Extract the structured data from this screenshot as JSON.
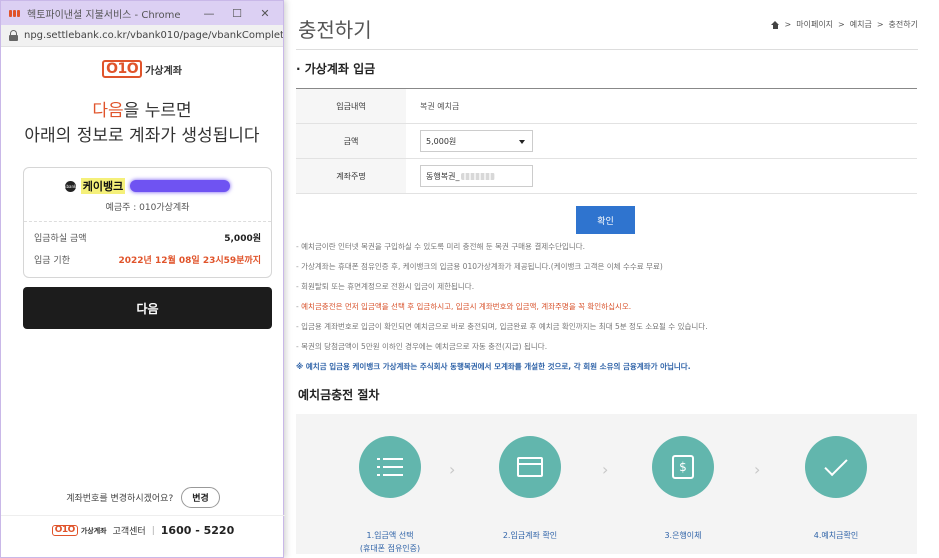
{
  "popup": {
    "window_title": "헥토파이낸셜 지불서비스 - Chrome",
    "url": "npg.settlebank.co.kr/vbank010/page/vbankComplete...",
    "logo": {
      "mark": "O1O",
      "text": "가상계좌"
    },
    "headline": {
      "accent": "다음",
      "line1_rest": "을 누르면",
      "line2": "아래의 정보로 계좌가 생성됩니다"
    },
    "card": {
      "bank_icon_text": "kbank",
      "bank_name": "케이뱅크",
      "holder": "예금주 : 010가상계좌",
      "amount_label": "입금하실 금액",
      "amount_value": "5,000원",
      "deadline_label": "입금 기한",
      "deadline_value": "2022년 12월 08일 23시59분까지"
    },
    "next_button": "다음",
    "change_question": "계좌번호를 변경하시겠어요?",
    "change_button": "변경",
    "footer": {
      "center_label": "고객센터",
      "separator": "|",
      "phone": "1600 - 5220"
    }
  },
  "page": {
    "title": "충전하기",
    "breadcrumb": [
      "마이페이지",
      "예치금",
      "충전하기"
    ],
    "breadcrumb_sep": ">",
    "section1": "· 가상계좌 입금",
    "form": {
      "deposit_label": "입금내역",
      "deposit_value": "복권 예치금",
      "amount_label": "금액",
      "amount_selected": "5,000원",
      "name_label": "계좌주명",
      "name_value": "동행복권_"
    },
    "confirm_button": "확인",
    "notes": [
      "예치금이란 인터넷 복권을 구입하실 수 있도록 미리 충전해 둔 복권 구매용 결제수단입니다.",
      "가상계좌는 휴대폰 점유인증 후, 케이뱅크의 입금용 010가상계좌가 제공됩니다.(케이뱅크 고객은 이체 수수료 무료)",
      "회원탈퇴 또는 휴면계정으로 전환시 입금이 제한됩니다.",
      "예치금충전은 먼저 입금액을 선택 후 입금하시고, 입금시 계좌번호와 입금액, 계좌주명을 꼭 확인하십시오.",
      "입금용 계좌번호로 입금이 확인되면 예치금으로 바로 충전되며, 입금완료 후 예치금 확인까지는 최대 5분 정도 소요될 수 있습니다.",
      "복권의 당첨금액이 5만원 이하인 경우에는 예치금으로 자동 충전(지급) 됩니다.",
      "※ 예치금 입금용 케이뱅크 가상계좌는 주식회사 동행복권에서 모계좌를 개설한 것으로, 각 회원 소유의 금융계좌가 아닙니다."
    ],
    "section2": "예치금충전 절차",
    "steps": [
      {
        "label": "1.입금액 선택",
        "sub": "(휴대폰 점유인증)",
        "icon": "list-icon"
      },
      {
        "label": "2.입금계좌 확인",
        "sub": "",
        "icon": "window-icon"
      },
      {
        "label": "3.은행이체",
        "sub": "",
        "icon": "dollar-icon"
      },
      {
        "label": "4.예치금확인",
        "sub": "",
        "icon": "check-icon"
      }
    ],
    "step_chevron": "›"
  },
  "colors": {
    "accent_orange": "#e0542b",
    "button_blue": "#2f74cf",
    "step_teal": "#62b6ad",
    "link_blue": "#2f63a8"
  }
}
